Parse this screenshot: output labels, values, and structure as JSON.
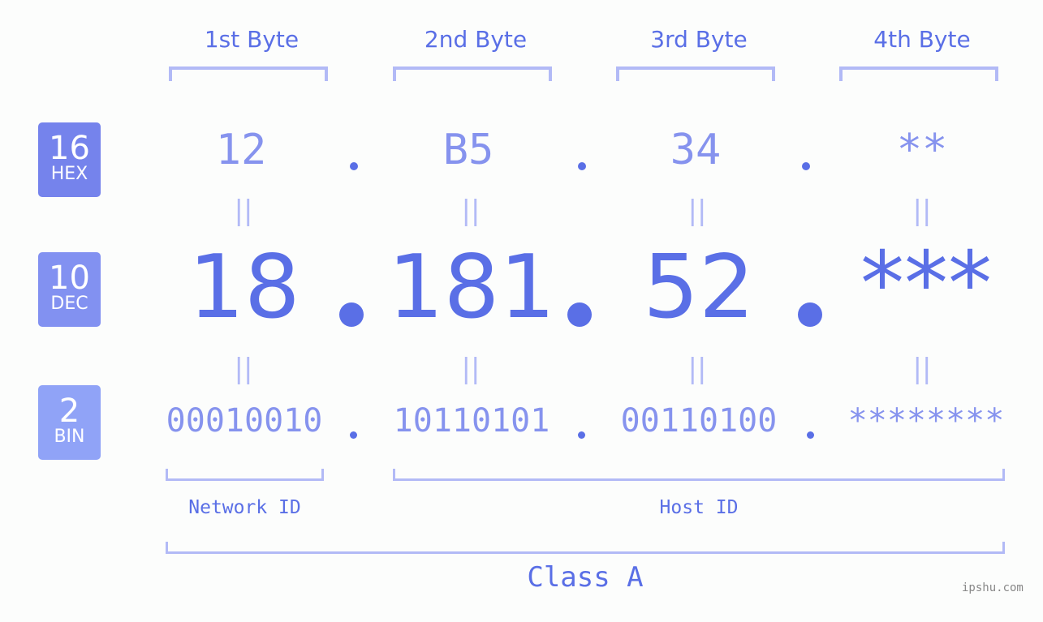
{
  "byte_headers": [
    "1st Byte",
    "2nd Byte",
    "3rd Byte",
    "4th Byte"
  ],
  "badges": {
    "hex": {
      "num": "16",
      "base": "HEX",
      "color": "#7583ec"
    },
    "dec": {
      "num": "10",
      "base": "DEC",
      "color": "#8291f1"
    },
    "bin": {
      "num": "2",
      "base": "BIN",
      "color": "#90a3f7"
    }
  },
  "hex_values": [
    "12",
    "B5",
    "34",
    "**"
  ],
  "dec_values": [
    "18",
    "181",
    "52",
    "***"
  ],
  "bin_values": [
    "00010010",
    "10110101",
    "00110100",
    "********"
  ],
  "equals_sign": "||",
  "network_id_label": "Network ID",
  "host_id_label": "Host ID",
  "class_label": "Class A",
  "watermark": "ipshu.com",
  "colors": {
    "accent": "#5a6fe6",
    "light_accent": "#8693ee",
    "bracket": "#b2baf6",
    "background": "#fcfdfc"
  }
}
